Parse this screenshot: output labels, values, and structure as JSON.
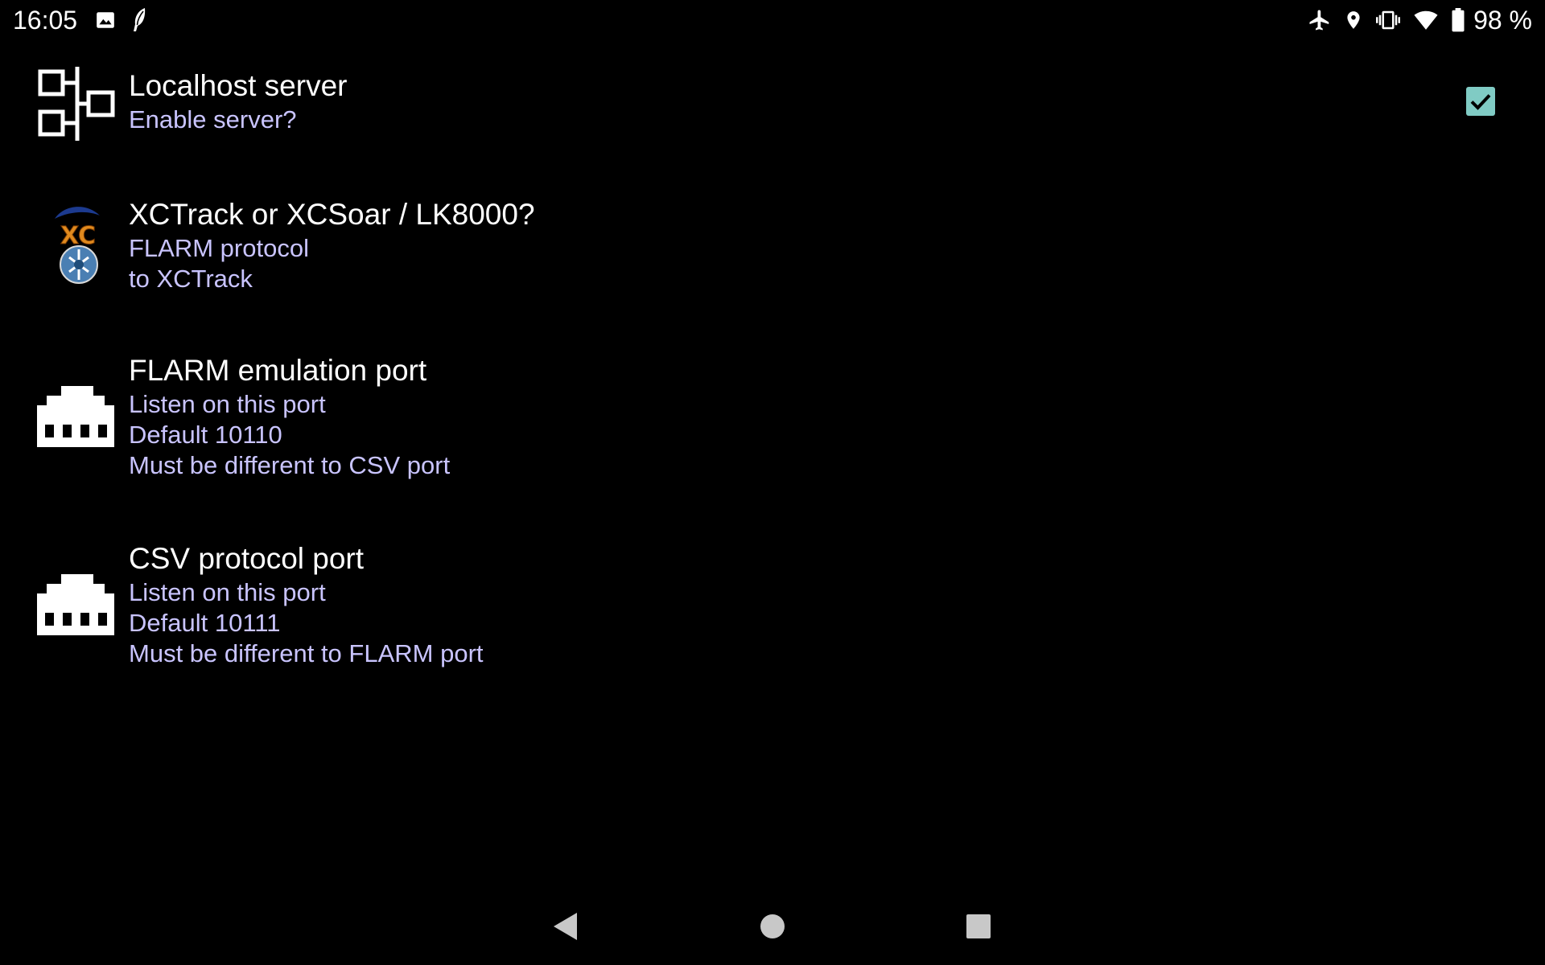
{
  "status_bar": {
    "time": "16:05",
    "battery_text": "98 %",
    "left_icons": [
      "image-icon",
      "notification-feather-icon"
    ],
    "right_icons": [
      "airplane-mode-icon",
      "location-icon",
      "vibrate-icon",
      "wifi-icon",
      "battery-icon"
    ]
  },
  "preferences": [
    {
      "name": "localhost-server",
      "title": "Localhost server",
      "summary": [
        "Enable server?"
      ],
      "icon": "network-tree-icon",
      "checked": true
    },
    {
      "name": "protocol-choice",
      "title": "XCTrack or XCSoar / LK8000?",
      "summary": [
        "FLARM protocol",
        "to XCTrack"
      ],
      "icon": "xc-logo-icon"
    },
    {
      "name": "flarm-port",
      "title": "FLARM emulation port",
      "summary": [
        "Listen on this port",
        "Default 10110",
        "Must be different to CSV port"
      ],
      "icon": "ethernet-port-icon"
    },
    {
      "name": "csv-port",
      "title": "CSV protocol port",
      "summary": [
        "Listen on this port",
        "Default 10111",
        "Must be different to FLARM port"
      ],
      "icon": "ethernet-port-icon"
    }
  ],
  "navigation": [
    "back-icon",
    "home-icon",
    "recents-icon"
  ],
  "colors": {
    "background": "#000000",
    "title": "#ffffff",
    "summary": "#c9c4ff",
    "checkbox": "#80cbc4"
  },
  "xc_logo_text": "XC"
}
